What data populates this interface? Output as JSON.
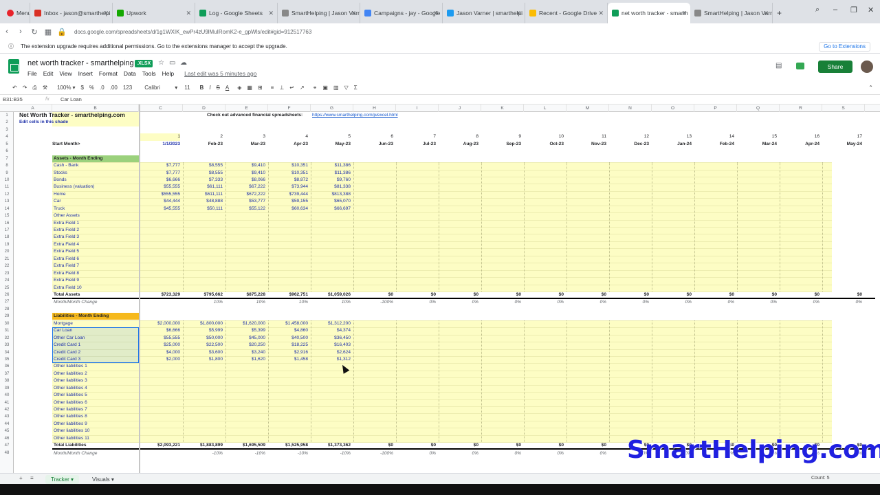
{
  "browser": {
    "tabs": [
      {
        "label": "Inbox - jason@smarthelpi",
        "color": "#d93025"
      },
      {
        "label": "Upwork",
        "color": "#14a800"
      },
      {
        "label": "Log - Google Sheets",
        "color": "#0f9d58"
      },
      {
        "label": "SmartHelping | Jason Varn",
        "color": "#888888"
      },
      {
        "label": "Campaigns - jay - Google",
        "color": "#4285f4"
      },
      {
        "label": "Jason Varner | smarthelpi",
        "color": "#1d9bf0"
      },
      {
        "label": "Recent - Google Drive",
        "color": "#fbbc04"
      },
      {
        "label": "net worth tracker - smarth",
        "color": "#0f9d58",
        "active": true
      },
      {
        "label": "SmartHelping | Jason Varn",
        "color": "#888888"
      }
    ],
    "menu_label": "Menu",
    "url": "docs.google.com/spreadsheets/d/1g1WXIK_ewPr4zU9lMuIRomK2-e_gpWls/edit#gid=912517763",
    "info_message": "The extension upgrade requires additional permissions. Go to the extensions manager to accept the upgrade.",
    "info_button": "Go to Extensions"
  },
  "app": {
    "title": "net worth tracker - smarthelping",
    "badge": ".XLSX",
    "menus": [
      "File",
      "Edit",
      "View",
      "Insert",
      "Format",
      "Data",
      "Tools",
      "Help"
    ],
    "last_edit": "Last edit was 5 minutes ago",
    "share_label": "Share"
  },
  "toolbar": {
    "zoom": "100%",
    "currency": "$",
    "percent": "%",
    "dec_less": ".0",
    "dec_more": ".00",
    "format123": "123",
    "font": "Calibri",
    "size": "11",
    "bold": "B",
    "italic": "I",
    "strike": "S",
    "textcolor": "A"
  },
  "formula": {
    "namebox": "B31:B35",
    "fx": "fx",
    "content": "Car Loan"
  },
  "columns": [
    "A",
    "B",
    "C",
    "D",
    "E",
    "F",
    "G",
    "H",
    "I",
    "J",
    "K",
    "L",
    "M",
    "N",
    "O",
    "P",
    "Q",
    "R",
    "S"
  ],
  "rows": [
    "1",
    "2",
    "3",
    "4",
    "5",
    "6",
    "7",
    "8",
    "9",
    "10",
    "11",
    "12",
    "13",
    "14",
    "15",
    "16",
    "17",
    "18",
    "19",
    "20",
    "21",
    "22",
    "23",
    "24",
    "25",
    "26",
    "27",
    "28",
    "29",
    "30",
    "31",
    "32",
    "33",
    "34",
    "35",
    "36",
    "37",
    "38",
    "39",
    "40",
    "41",
    "42",
    "43",
    "44",
    "45",
    "46",
    "47",
    "48"
  ],
  "sheet": {
    "title": "Net Worth Tracker - smarthelping.com",
    "subtitle": "Edit cells in this shade",
    "advert": "Check out advanced financial spreadsheets:",
    "advert_link": "https://www.smarthelping.com/p/excel.html",
    "start_label": "Start Month>",
    "month_numbers": [
      "1",
      "2",
      "3",
      "4",
      "5",
      "6",
      "7",
      "8",
      "9",
      "10",
      "11",
      "12",
      "13",
      "14",
      "15",
      "16",
      "17"
    ],
    "months": [
      "1/1/2023",
      "Feb-23",
      "Mar-23",
      "Apr-23",
      "May-23",
      "Jun-23",
      "Jul-23",
      "Aug-23",
      "Sep-23",
      "Oct-23",
      "Nov-23",
      "Dec-23",
      "Jan-24",
      "Feb-24",
      "Mar-24",
      "Apr-24",
      "May-24"
    ],
    "assets_header": "Assets - Month Ending",
    "assets": [
      {
        "label": "Cash - Bank",
        "values": [
          "$7,777",
          "$8,555",
          "$9,410",
          "$10,351",
          "$11,386"
        ]
      },
      {
        "label": "Stocks",
        "values": [
          "$7,777",
          "$8,555",
          "$9,410",
          "$10,351",
          "$11,386"
        ]
      },
      {
        "label": "Bonds",
        "values": [
          "$6,666",
          "$7,333",
          "$8,066",
          "$8,872",
          "$9,760"
        ]
      },
      {
        "label": "Business (valuation)",
        "values": [
          "$55,555",
          "$61,111",
          "$67,222",
          "$73,944",
          "$81,338"
        ]
      },
      {
        "label": "Home",
        "values": [
          "$555,555",
          "$611,111",
          "$672,222",
          "$739,444",
          "$813,388"
        ]
      },
      {
        "label": "Car",
        "values": [
          "$44,444",
          "$48,888",
          "$53,777",
          "$59,155",
          "$65,070"
        ]
      },
      {
        "label": "Truck",
        "values": [
          "$45,555",
          "$50,111",
          "$55,122",
          "$60,634",
          "$66,697"
        ]
      },
      {
        "label": "Other Assets",
        "values": []
      },
      {
        "label": "Extra Field 1",
        "values": []
      },
      {
        "label": "Extra Field 2",
        "values": []
      },
      {
        "label": "Extra Field 3",
        "values": []
      },
      {
        "label": "Extra Field 4",
        "values": []
      },
      {
        "label": "Extra Field 5",
        "values": []
      },
      {
        "label": "Extra Field 6",
        "values": []
      },
      {
        "label": "Extra Field 7",
        "values": []
      },
      {
        "label": "Extra Field 8",
        "values": []
      },
      {
        "label": "Extra Field 9",
        "values": []
      },
      {
        "label": "Extra Field 10",
        "values": []
      }
    ],
    "total_assets_label": "Total Assets",
    "total_assets": [
      "$723,329",
      "$795,662",
      "$875,228",
      "$962,751",
      "$1,059,026",
      "$0",
      "$0",
      "$0",
      "$0",
      "$0",
      "$0",
      "$0",
      "$0",
      "$0",
      "$0",
      "$0",
      "$0"
    ],
    "change_label": "Month/Month Change",
    "assets_change": [
      "",
      "10%",
      "10%",
      "10%",
      "10%",
      "-100%",
      "0%",
      "0%",
      "0%",
      "0%",
      "0%",
      "0%",
      "0%",
      "0%",
      "0%",
      "0%",
      "0%"
    ],
    "liab_header": "Liabilities - Month Ending",
    "liabilities": [
      {
        "label": "Mortgage",
        "values": [
          "$2,000,000",
          "$1,800,000",
          "$1,620,000",
          "$1,458,000",
          "$1,312,200"
        ]
      },
      {
        "label": "Car Loan",
        "values": [
          "$6,666",
          "$5,999",
          "$5,399",
          "$4,860",
          "$4,374"
        ]
      },
      {
        "label": "Other Car Loan",
        "values": [
          "$55,555",
          "$50,000",
          "$45,000",
          "$40,500",
          "$36,450"
        ]
      },
      {
        "label": "Credit Card 1",
        "values": [
          "$25,000",
          "$22,500",
          "$20,250",
          "$18,225",
          "$16,403"
        ]
      },
      {
        "label": "Credit Card 2",
        "values": [
          "$4,000",
          "$3,600",
          "$3,240",
          "$2,916",
          "$2,624"
        ]
      },
      {
        "label": "Credit Card 3",
        "values": [
          "$2,000",
          "$1,800",
          "$1,620",
          "$1,458",
          "$1,312"
        ]
      },
      {
        "label": "Other liabilities 1",
        "values": []
      },
      {
        "label": "Other liabilities 2",
        "values": []
      },
      {
        "label": "Other liabilities 3",
        "values": []
      },
      {
        "label": "Other liabilities 4",
        "values": []
      },
      {
        "label": "Other liabilities 5",
        "values": []
      },
      {
        "label": "Other liabilities 6",
        "values": []
      },
      {
        "label": "Other liabilities 7",
        "values": []
      },
      {
        "label": "Other liabilities 8",
        "values": []
      },
      {
        "label": "Other liabilities 9",
        "values": []
      },
      {
        "label": "Other liabilities 10",
        "values": []
      },
      {
        "label": "Other liabilities 11",
        "values": []
      }
    ],
    "total_liab_label": "Total Liabilities",
    "total_liab": [
      "$2,093,221",
      "$1,883,899",
      "$1,695,509",
      "$1,525,958",
      "$1,373,362",
      "$0",
      "$0",
      "$0",
      "$0",
      "$0",
      "$0",
      "$0",
      "$0",
      "$0",
      "$0",
      "$0",
      "$0"
    ],
    "liab_change": [
      "",
      "-10%",
      "-10%",
      "-10%",
      "-10%",
      "-100%",
      "0%",
      "0%",
      "0%",
      "0%",
      "0%",
      "0%",
      "0%",
      "0%",
      "0%",
      "0%",
      "0%"
    ]
  },
  "bottom": {
    "tabs": [
      "Tracker",
      "Visuals"
    ],
    "count": "Count: 5"
  },
  "watermark": "SmartHelping.com",
  "colors": {
    "edit_shade": "#fdfdc4",
    "assets_header": "#9bd17c",
    "liab_header": "#f6b91c",
    "share": "#188038"
  }
}
